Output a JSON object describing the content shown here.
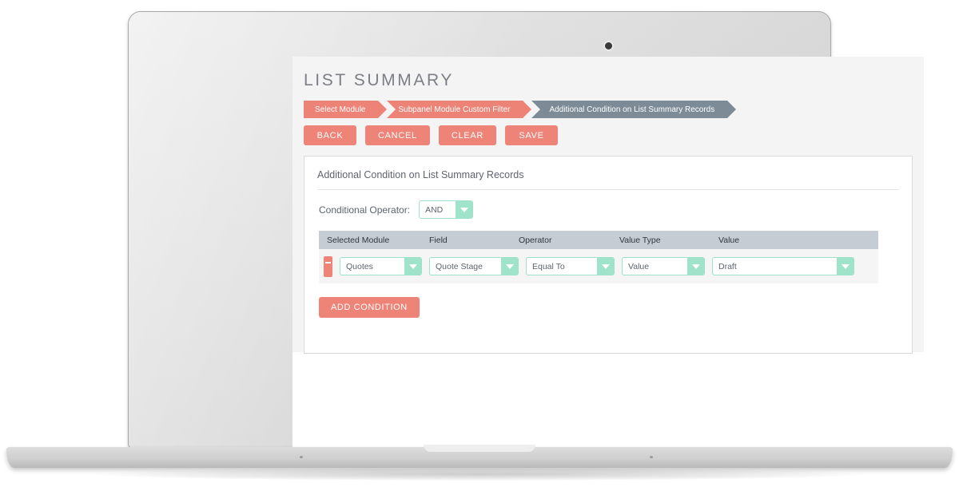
{
  "page": {
    "title": "LIST SUMMARY"
  },
  "breadcrumb": {
    "steps": [
      {
        "label": "Select Module",
        "state": "done"
      },
      {
        "label": "Subpanel Module Custom Filter",
        "state": "done"
      },
      {
        "label": "Additional Condition on List Summary Records",
        "state": "active"
      }
    ]
  },
  "actions": {
    "buttons": [
      {
        "label": "BACK",
        "name": "back-button"
      },
      {
        "label": "CANCEL",
        "name": "cancel-button"
      },
      {
        "label": "CLEAR",
        "name": "clear-button"
      },
      {
        "label": "SAVE",
        "name": "save-button"
      }
    ]
  },
  "panel": {
    "title": "Additional Condition on List Summary Records",
    "conditional_operator": {
      "label": "Conditional Operator:",
      "value": "AND"
    },
    "table": {
      "headers": [
        "Selected Module",
        "Field",
        "Operator",
        "Value Type",
        "Value"
      ],
      "rows": [
        {
          "selected_module": "Quotes",
          "field": "Quote Stage",
          "operator": "Equal To",
          "value_type": "Value",
          "value": "Draft"
        }
      ]
    },
    "add_condition_label": "ADD CONDITION"
  },
  "colors": {
    "accent_salmon": "#ee8377",
    "breadcrumb_active": "#7d8b96",
    "dropdown_mint": "#9fe3cb",
    "table_header": "#c6ccd4",
    "app_background": "#f4f4f4"
  },
  "icons": {
    "dropdown_arrow": "chevron-down-icon",
    "remove_condition": "minus-icon",
    "webcam": "camera-icon"
  }
}
